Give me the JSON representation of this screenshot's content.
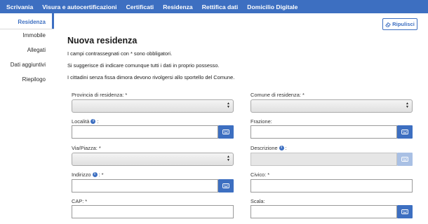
{
  "topnav": {
    "items": [
      "Scrivania",
      "Visura e autocertificazioni",
      "Certificati",
      "Residenza",
      "Rettifica dati",
      "Domicilio Digitale"
    ]
  },
  "sidebar": {
    "items": [
      {
        "label": "Residenza",
        "active": true
      },
      {
        "label": "Immobile",
        "active": false
      },
      {
        "label": "Allegati",
        "active": false
      },
      {
        "label": "Dati aggiuntivi",
        "active": false
      },
      {
        "label": "Riepilogo",
        "active": false
      }
    ]
  },
  "toolbar": {
    "ripulisci_label": "Ripulisci",
    "ripulisci_icon": "eraser-icon"
  },
  "page": {
    "title": "Nuova residenza",
    "paragraphs": [
      "I campi contrassegnati con * sono obbligatori.",
      "Si suggerisce di indicare comunque tutti i dati in proprio possesso.",
      "I cittadini senza fissa dimora devono rivolgersi allo sportello del Comune."
    ]
  },
  "form": {
    "provincia": {
      "label": "Provincia di residenza: *",
      "value": ""
    },
    "comune": {
      "label": "Comune di residenza: *",
      "value": ""
    },
    "localita": {
      "label": "Località",
      "suffix": ":",
      "value": ""
    },
    "frazione": {
      "label": "Frazione:",
      "value": ""
    },
    "via_piazza": {
      "label": "Via/Piazza: *",
      "value": ""
    },
    "descrizione": {
      "label": "Descrizione",
      "suffix": ":",
      "value": ""
    },
    "indirizzo": {
      "label": "Indirizzo",
      "suffix": ": *",
      "value": ""
    },
    "civico": {
      "label": "Civico: *",
      "value": ""
    },
    "cap": {
      "label": "CAP: *",
      "value": ""
    },
    "scala": {
      "label": "Scala:",
      "value": ""
    }
  },
  "icons": {
    "info": "info-icon",
    "keyboard": "keyboard-icon",
    "select_arrows": "select-arrows-icon"
  },
  "colors": {
    "accent": "#3d6fc1",
    "accent_disabled": "#a9c0e4"
  }
}
